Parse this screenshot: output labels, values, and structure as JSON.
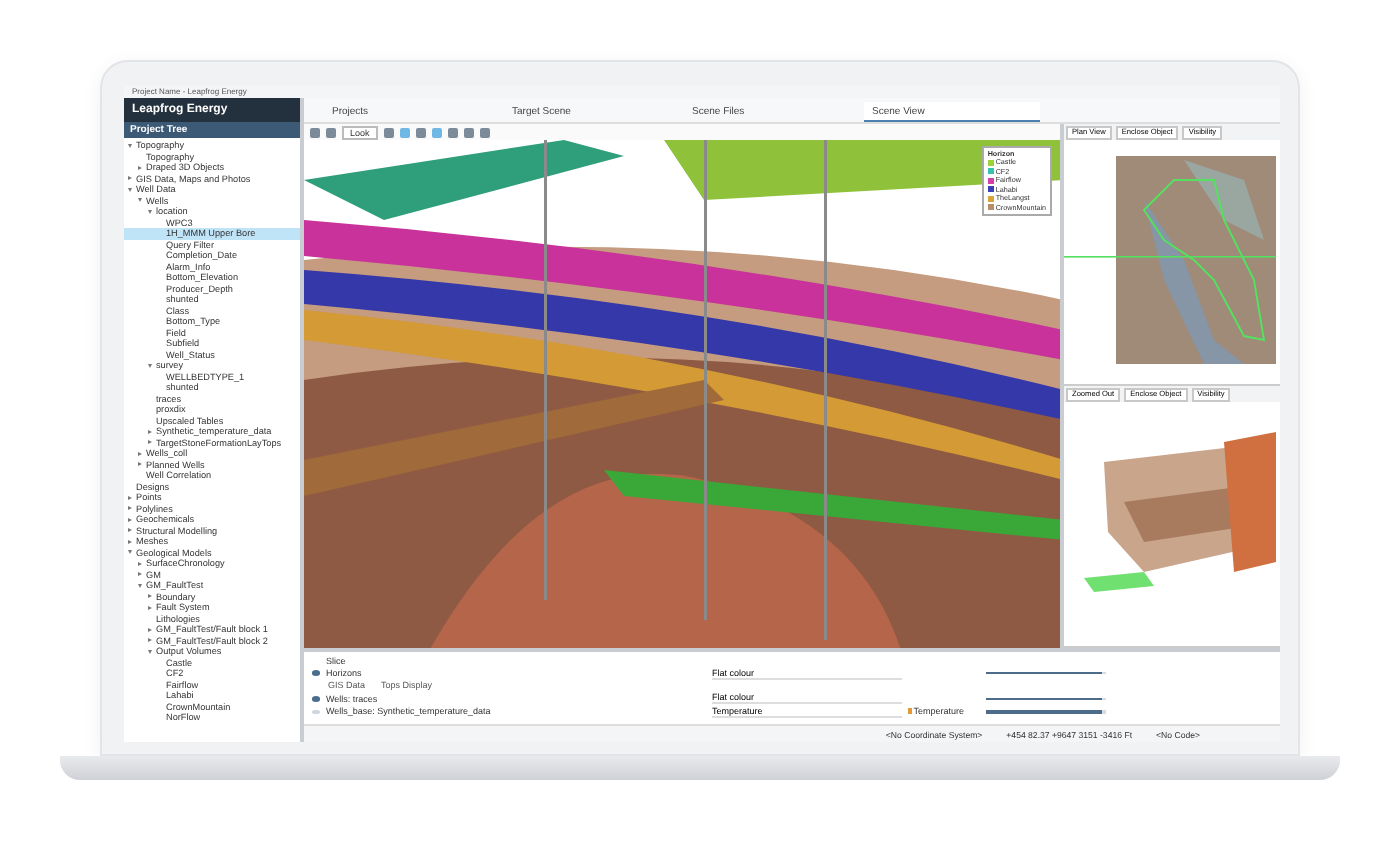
{
  "window": {
    "title": "Project Name - Leapfrog Energy"
  },
  "brand": "Leapfrog Energy",
  "tabs": [
    {
      "label": "Projects",
      "selected": false
    },
    {
      "label": "Target Scene",
      "selected": false
    },
    {
      "label": "Scene Files",
      "selected": false
    },
    {
      "label": "Scene View",
      "selected": true
    }
  ],
  "project_tree": {
    "title": "Project Tree",
    "items": [
      {
        "label": "Topography",
        "selected": false,
        "expanded": true,
        "children": [
          {
            "label": "Topography",
            "selected": false
          },
          {
            "label": "Draped 3D Objects",
            "selected": false,
            "expanded": false
          }
        ]
      },
      {
        "label": "GIS Data, Maps and Photos",
        "selected": false,
        "expanded": false
      },
      {
        "label": "Well Data",
        "selected": false,
        "expanded": true,
        "children": [
          {
            "label": "Wells",
            "selected": false,
            "expanded": true,
            "children": [
              {
                "label": "location",
                "selected": false,
                "expanded": true,
                "children": [
                  {
                    "label": "WPC3",
                    "selected": false
                  },
                  {
                    "label": "1H_MMM Upper Bore",
                    "selected": true
                  },
                  {
                    "label": "Query Filter",
                    "selected": false
                  },
                  {
                    "label": "Completion_Date",
                    "selected": false
                  },
                  {
                    "label": "Alarm_Info",
                    "selected": false
                  },
                  {
                    "label": "Bottom_Elevation",
                    "selected": false
                  },
                  {
                    "label": "Producer_Depth",
                    "selected": false
                  },
                  {
                    "label": "shunted",
                    "selected": false
                  },
                  {
                    "label": "Class",
                    "selected": false
                  },
                  {
                    "label": "Bottom_Type",
                    "selected": false
                  },
                  {
                    "label": "Field",
                    "selected": false
                  },
                  {
                    "label": "Subfield",
                    "selected": false
                  },
                  {
                    "label": "Well_Status",
                    "selected": false
                  }
                ]
              },
              {
                "label": "survey",
                "selected": false,
                "expanded": true,
                "children": [
                  {
                    "label": "WELLBEDTYPE_1",
                    "selected": false
                  },
                  {
                    "label": "shunted",
                    "selected": false
                  }
                ]
              },
              {
                "label": "traces",
                "selected": false
              },
              {
                "label": "proxdix",
                "selected": false
              },
              {
                "label": "Upscaled Tables",
                "selected": false
              },
              {
                "label": "Synthetic_temperature_data",
                "selected": false,
                "expanded": false
              },
              {
                "label": "TargetStoneFormationLayTops",
                "selected": false,
                "expanded": false
              }
            ]
          },
          {
            "label": "Wells_coll",
            "selected": false,
            "expanded": false
          },
          {
            "label": "Planned Wells",
            "selected": false,
            "expanded": false
          },
          {
            "label": "Well Correlation",
            "selected": false
          }
        ]
      },
      {
        "label": "Designs",
        "selected": false
      },
      {
        "label": "Points",
        "selected": false,
        "expanded": false
      },
      {
        "label": "Polylines",
        "selected": false,
        "expanded": false
      },
      {
        "label": "Geochemicals",
        "selected": false,
        "expanded": false
      },
      {
        "label": "Structural Modelling",
        "selected": false,
        "expanded": false
      },
      {
        "label": "Meshes",
        "selected": false,
        "expanded": false
      },
      {
        "label": "Geological Models",
        "selected": false,
        "expanded": true,
        "children": [
          {
            "label": "SurfaceChronology",
            "selected": false,
            "expanded": false
          },
          {
            "label": "GM",
            "selected": false,
            "expanded": false
          },
          {
            "label": "GM_FaultTest",
            "selected": false,
            "expanded": true,
            "children": [
              {
                "label": "Boundary",
                "selected": false,
                "expanded": false
              },
              {
                "label": "Fault System",
                "selected": false,
                "expanded": false
              },
              {
                "label": "Lithologies",
                "selected": false
              },
              {
                "label": "GM_FaultTest/Fault block 1",
                "selected": false,
                "expanded": false
              },
              {
                "label": "GM_FaultTest/Fault block 2",
                "selected": false,
                "expanded": false
              },
              {
                "label": "Output Volumes",
                "selected": false,
                "expanded": true,
                "children": [
                  {
                    "label": "Castle",
                    "selected": false
                  },
                  {
                    "label": "CF2",
                    "selected": false
                  },
                  {
                    "label": "Fairflow",
                    "selected": false
                  },
                  {
                    "label": "Lahabi",
                    "selected": false
                  },
                  {
                    "label": "CrownMountain",
                    "selected": false
                  },
                  {
                    "label": "NorFlow",
                    "selected": false
                  }
                ]
              }
            ]
          }
        ]
      }
    ]
  },
  "toolbar": {
    "look": "Look"
  },
  "legend": {
    "title": "Horizon",
    "items": [
      {
        "label": "Castle",
        "color": "#9ed23a"
      },
      {
        "label": "CF2",
        "color": "#38c3b0"
      },
      {
        "label": "Fairflow",
        "color": "#d63fa8"
      },
      {
        "label": "Lahabi",
        "color": "#3b3fb8"
      },
      {
        "label": "TheLangst",
        "color": "#d9a43a"
      },
      {
        "label": "CrownMountain",
        "color": "#b98c6a"
      }
    ]
  },
  "side_views": [
    {
      "buttons": [
        "Plan View",
        "Enclose Object",
        "Visibility"
      ],
      "kind": "map"
    },
    {
      "buttons": [
        "Zoomed Out",
        "Enclose Object",
        "Visibility"
      ],
      "kind": "model"
    }
  ],
  "shapes": {
    "rows": [
      {
        "name": "Slice",
        "kind": "slice"
      },
      {
        "name": "Horizons",
        "kind": "layer",
        "visible": true,
        "style": "Flat colour",
        "level": 0.96,
        "sub": [
          "GIS Data",
          "Tops Display"
        ]
      },
      {
        "name": "Wells: traces",
        "kind": "layer",
        "visible": true,
        "style": "Flat colour",
        "level": 0.96
      },
      {
        "name": "Wells_base: Synthetic_temperature_data",
        "kind": "layer",
        "visible": false,
        "style": "Temperature",
        "legend": "Temperature",
        "level": 0.96
      }
    ]
  },
  "status_bar": {
    "coordinate_system": "<No Coordinate System>",
    "position": "+454 82.37 +9647 3151 -3416 Ft",
    "code": "<No Code>"
  }
}
